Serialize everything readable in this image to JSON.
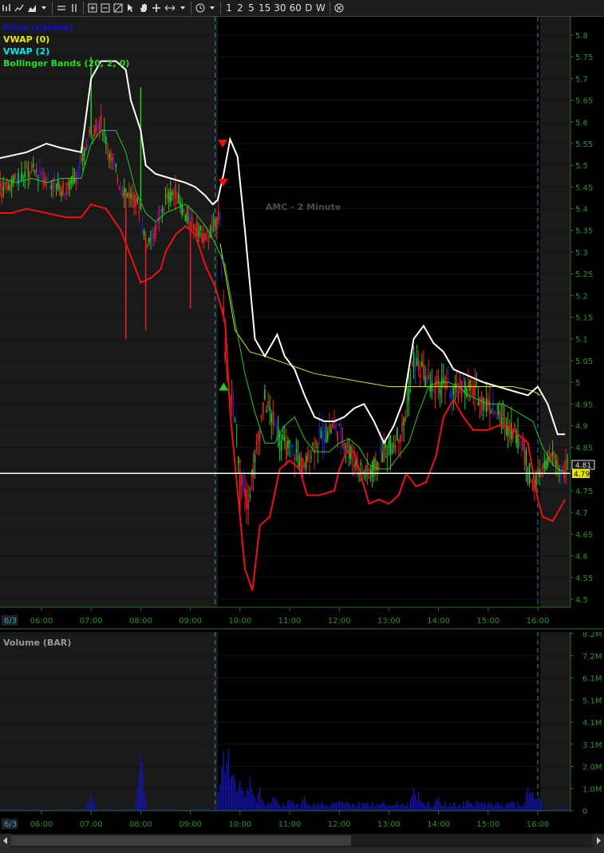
{
  "toolbar": {
    "timeframes": [
      "1",
      "2",
      "5",
      "15",
      "30",
      "60",
      "D",
      "W"
    ]
  },
  "chart_data": [
    {
      "type": "candlestick",
      "title": "AMC - 2 Minute",
      "legend": [
        {
          "name": "Price (Candle)",
          "color": "#1010d0"
        },
        {
          "name": "VWAP (0)",
          "color": "#e8e800"
        },
        {
          "name": "VWAP (2)",
          "color": "#00e8e8"
        },
        {
          "name": "Bollinger Bands (20, 2, 0)",
          "color": "#22dd22"
        }
      ],
      "ylim": [
        4.5,
        5.8
      ],
      "y_ticks": [
        "5.8",
        "5.75",
        "5.7",
        "5.65",
        "5.6",
        "5.55",
        "5.5",
        "5.45",
        "5.4",
        "5.35",
        "5.3",
        "5.25",
        "5.2",
        "5.15",
        "5.1",
        "5.05",
        "5",
        "4.95",
        "4.9",
        "4.85",
        "4.8",
        "4.75",
        "4.7",
        "4.65",
        "4.6",
        "4.55",
        "4.5"
      ],
      "x_ticks": [
        "06:00",
        "07:00",
        "08:00",
        "09:00",
        "10:00",
        "11:00",
        "12:00",
        "13:00",
        "14:00",
        "15:00",
        "16:00"
      ],
      "date_label": "6/3",
      "last_price_labels": [
        "4.81",
        "4.79"
      ],
      "horizontal_line": 4.79,
      "session_markers": [
        "09:30",
        "16:00"
      ],
      "series": {
        "bb_upper": [
          [
            4.0,
            5.74
          ],
          [
            4.2,
            5.63
          ],
          [
            4.5,
            5.52
          ],
          [
            4.9,
            5.51
          ],
          [
            5.3,
            5.52
          ],
          [
            5.7,
            5.53
          ],
          [
            6.1,
            5.55
          ],
          [
            6.4,
            5.54
          ],
          [
            6.8,
            5.53
          ],
          [
            7.0,
            5.7
          ],
          [
            7.2,
            5.74
          ],
          [
            7.5,
            5.74
          ],
          [
            7.7,
            5.72
          ],
          [
            7.8,
            5.65
          ],
          [
            8.0,
            5.58
          ],
          [
            8.1,
            5.5
          ],
          [
            8.3,
            5.48
          ],
          [
            8.6,
            5.47
          ],
          [
            8.9,
            5.46
          ],
          [
            9.1,
            5.45
          ],
          [
            9.3,
            5.43
          ],
          [
            9.45,
            5.41
          ],
          [
            9.55,
            5.42
          ],
          [
            9.67,
            5.48
          ],
          [
            9.8,
            5.56
          ],
          [
            9.95,
            5.52
          ],
          [
            10.1,
            5.35
          ],
          [
            10.3,
            5.1
          ],
          [
            10.5,
            5.06
          ],
          [
            10.6,
            5.08
          ],
          [
            10.75,
            5.11
          ],
          [
            10.9,
            5.06
          ],
          [
            11.1,
            5.03
          ],
          [
            11.3,
            4.97
          ],
          [
            11.5,
            4.92
          ],
          [
            11.7,
            4.91
          ],
          [
            11.9,
            4.91
          ],
          [
            12.1,
            4.92
          ],
          [
            12.3,
            4.94
          ],
          [
            12.5,
            4.95
          ],
          [
            12.7,
            4.91
          ],
          [
            12.9,
            4.86
          ],
          [
            13.1,
            4.9
          ],
          [
            13.3,
            4.96
          ],
          [
            13.5,
            5.1
          ],
          [
            13.7,
            5.13
          ],
          [
            13.9,
            5.09
          ],
          [
            14.1,
            5.07
          ],
          [
            14.3,
            5.03
          ],
          [
            14.5,
            5.02
          ],
          [
            14.7,
            5.01
          ],
          [
            14.9,
            5.0
          ],
          [
            15.2,
            4.99
          ],
          [
            15.5,
            4.98
          ],
          [
            15.8,
            4.97
          ],
          [
            16.0,
            4.99
          ],
          [
            16.2,
            4.95
          ],
          [
            16.4,
            4.88
          ],
          [
            16.55,
            4.88
          ]
        ],
        "bb_lower": [
          [
            4.0,
            5.3
          ],
          [
            4.3,
            5.28
          ],
          [
            4.6,
            5.33
          ],
          [
            4.9,
            5.38
          ],
          [
            5.1,
            5.39
          ],
          [
            5.4,
            5.39
          ],
          [
            5.7,
            5.4
          ],
          [
            6.1,
            5.39
          ],
          [
            6.5,
            5.38
          ],
          [
            6.8,
            5.38
          ],
          [
            7.0,
            5.41
          ],
          [
            7.3,
            5.4
          ],
          [
            7.6,
            5.35
          ],
          [
            7.8,
            5.29
          ],
          [
            8.0,
            5.23
          ],
          [
            8.2,
            5.24
          ],
          [
            8.4,
            5.26
          ],
          [
            8.5,
            5.3
          ],
          [
            8.7,
            5.34
          ],
          [
            8.9,
            5.36
          ],
          [
            9.1,
            5.34
          ],
          [
            9.3,
            5.27
          ],
          [
            9.5,
            5.22
          ],
          [
            9.7,
            5.14
          ],
          [
            9.8,
            4.93
          ],
          [
            9.95,
            4.75
          ],
          [
            10.1,
            4.57
          ],
          [
            10.25,
            4.52
          ],
          [
            10.4,
            4.67
          ],
          [
            10.6,
            4.69
          ],
          [
            10.8,
            4.8
          ],
          [
            11.0,
            4.82
          ],
          [
            11.2,
            4.8
          ],
          [
            11.35,
            4.74
          ],
          [
            11.6,
            4.74
          ],
          [
            11.9,
            4.75
          ],
          [
            12.0,
            4.8
          ],
          [
            12.15,
            4.84
          ],
          [
            12.3,
            4.84
          ],
          [
            12.45,
            4.78
          ],
          [
            12.6,
            4.72
          ],
          [
            12.8,
            4.73
          ],
          [
            13.0,
            4.72
          ],
          [
            13.2,
            4.74
          ],
          [
            13.35,
            4.79
          ],
          [
            13.55,
            4.76
          ],
          [
            13.75,
            4.77
          ],
          [
            13.95,
            4.83
          ],
          [
            14.1,
            4.92
          ],
          [
            14.3,
            4.96
          ],
          [
            14.5,
            4.92
          ],
          [
            14.7,
            4.89
          ],
          [
            15.0,
            4.89
          ],
          [
            15.2,
            4.9
          ],
          [
            15.4,
            4.9
          ],
          [
            15.6,
            4.88
          ],
          [
            15.8,
            4.86
          ],
          [
            16.0,
            4.73
          ],
          [
            16.1,
            4.69
          ],
          [
            16.3,
            4.68
          ],
          [
            16.55,
            4.73
          ]
        ],
        "bb_mid": [
          [
            4.0,
            5.53
          ],
          [
            4.3,
            5.46
          ],
          [
            4.6,
            5.42
          ],
          [
            4.9,
            5.46
          ],
          [
            5.2,
            5.47
          ],
          [
            5.5,
            5.46
          ],
          [
            5.8,
            5.47
          ],
          [
            6.1,
            5.46
          ],
          [
            6.4,
            5.47
          ],
          [
            6.8,
            5.47
          ],
          [
            7.0,
            5.55
          ],
          [
            7.2,
            5.58
          ],
          [
            7.5,
            5.58
          ],
          [
            7.7,
            5.53
          ],
          [
            7.9,
            5.44
          ],
          [
            8.1,
            5.39
          ],
          [
            8.3,
            5.37
          ],
          [
            8.5,
            5.39
          ],
          [
            8.7,
            5.4
          ],
          [
            8.9,
            5.41
          ],
          [
            9.1,
            5.39
          ],
          [
            9.3,
            5.36
          ],
          [
            9.5,
            5.32
          ],
          [
            9.7,
            5.27
          ],
          [
            9.9,
            5.14
          ],
          [
            10.1,
            5.02
          ],
          [
            10.3,
            4.93
          ],
          [
            10.5,
            4.86
          ],
          [
            10.7,
            4.86
          ],
          [
            10.9,
            4.9
          ],
          [
            11.1,
            4.92
          ],
          [
            11.3,
            4.87
          ],
          [
            11.5,
            4.84
          ],
          [
            11.8,
            4.84
          ],
          [
            12.0,
            4.86
          ],
          [
            12.2,
            4.87
          ],
          [
            12.4,
            4.85
          ],
          [
            12.6,
            4.81
          ],
          [
            12.8,
            4.8
          ],
          [
            13.0,
            4.8
          ],
          [
            13.2,
            4.83
          ],
          [
            13.4,
            4.86
          ],
          [
            13.6,
            4.93
          ],
          [
            13.8,
            4.99
          ],
          [
            14.0,
            5.0
          ],
          [
            14.2,
            5.0
          ],
          [
            14.4,
            4.99
          ],
          [
            14.6,
            4.97
          ],
          [
            14.8,
            4.96
          ],
          [
            15.0,
            4.95
          ],
          [
            15.3,
            4.95
          ],
          [
            15.6,
            4.93
          ],
          [
            15.9,
            4.91
          ],
          [
            16.1,
            4.85
          ],
          [
            16.3,
            4.81
          ],
          [
            16.55,
            4.79
          ]
        ],
        "vwap": [
          [
            9.6,
            5.32
          ],
          [
            9.9,
            5.12
          ],
          [
            10.2,
            5.07
          ],
          [
            10.5,
            5.06
          ],
          [
            11.0,
            5.04
          ],
          [
            11.5,
            5.02
          ],
          [
            12.0,
            5.01
          ],
          [
            12.5,
            5.0
          ],
          [
            13.0,
            4.99
          ],
          [
            13.5,
            4.99
          ],
          [
            14.0,
            4.99
          ],
          [
            14.5,
            4.99
          ],
          [
            15.0,
            4.99
          ],
          [
            15.5,
            4.99
          ],
          [
            15.9,
            4.98
          ],
          [
            16.05,
            4.97
          ]
        ],
        "price_path": [
          [
            4.0,
            5.4
          ],
          [
            4.3,
            5.38
          ],
          [
            4.6,
            5.45
          ],
          [
            4.9,
            5.48
          ],
          [
            5.2,
            5.44
          ],
          [
            5.5,
            5.47
          ],
          [
            5.8,
            5.49
          ],
          [
            6.2,
            5.46
          ],
          [
            6.5,
            5.44
          ],
          [
            6.8,
            5.5
          ],
          [
            7.0,
            5.58
          ],
          [
            7.2,
            5.6
          ],
          [
            7.4,
            5.52
          ],
          [
            7.6,
            5.45
          ],
          [
            7.8,
            5.43
          ],
          [
            8.0,
            5.4
          ],
          [
            8.1,
            5.32
          ],
          [
            8.3,
            5.35
          ],
          [
            8.5,
            5.42
          ],
          [
            8.7,
            5.44
          ],
          [
            8.9,
            5.38
          ],
          [
            9.1,
            5.36
          ],
          [
            9.3,
            5.33
          ],
          [
            9.5,
            5.36
          ],
          [
            9.6,
            5.4
          ],
          [
            9.7,
            5.05
          ],
          [
            9.85,
            4.95
          ],
          [
            10.0,
            4.8
          ],
          [
            10.15,
            4.72
          ],
          [
            10.3,
            4.82
          ],
          [
            10.5,
            4.96
          ],
          [
            10.7,
            4.9
          ],
          [
            10.9,
            4.85
          ],
          [
            11.1,
            4.84
          ],
          [
            11.3,
            4.8
          ],
          [
            11.5,
            4.86
          ],
          [
            11.7,
            4.88
          ],
          [
            11.9,
            4.9
          ],
          [
            12.1,
            4.87
          ],
          [
            12.3,
            4.82
          ],
          [
            12.5,
            4.79
          ],
          [
            12.7,
            4.8
          ],
          [
            12.9,
            4.84
          ],
          [
            13.1,
            4.86
          ],
          [
            13.3,
            4.9
          ],
          [
            13.5,
            5.05
          ],
          [
            13.7,
            5.02
          ],
          [
            13.9,
            4.98
          ],
          [
            14.1,
            5.0
          ],
          [
            14.3,
            4.97
          ],
          [
            14.5,
            4.99
          ],
          [
            14.7,
            4.98
          ],
          [
            14.9,
            4.96
          ],
          [
            15.1,
            4.94
          ],
          [
            15.3,
            4.91
          ],
          [
            15.5,
            4.89
          ],
          [
            15.7,
            4.85
          ],
          [
            15.9,
            4.76
          ],
          [
            16.1,
            4.8
          ],
          [
            16.3,
            4.83
          ],
          [
            16.5,
            4.79
          ],
          [
            16.6,
            4.81
          ]
        ],
        "candle_spikes": [
          [
            7.0,
            5.75
          ],
          [
            8.0,
            5.68
          ],
          [
            8.1,
            5.12
          ],
          [
            7.7,
            5.1
          ],
          [
            9.0,
            5.17
          ],
          [
            10.0,
            4.7
          ],
          [
            10.25,
            4.8
          ]
        ],
        "sell_arrows": [
          [
            9.65,
            5.55
          ],
          [
            9.66,
            5.46
          ]
        ],
        "buy_arrows": [
          [
            9.67,
            4.99
          ]
        ]
      }
    },
    {
      "type": "bar",
      "title": "Volume (BAR)",
      "ylim": [
        0,
        8200000
      ],
      "y_ticks": [
        "8.2M",
        "7.2M",
        "6.1M",
        "5.1M",
        "4.1M",
        "3.1M",
        "2.0M",
        "1.0M",
        "0"
      ],
      "x_ticks": [
        "06:00",
        "07:00",
        "08:00",
        "09:00",
        "10:00",
        "11:00",
        "12:00",
        "13:00",
        "14:00",
        "15:00",
        "16:00"
      ],
      "date_label": "6/3",
      "spikes": [
        [
          7.0,
          1100000
        ],
        [
          8.0,
          3100000
        ],
        [
          9.65,
          3300000
        ],
        [
          9.75,
          4000000
        ],
        [
          9.85,
          2800000
        ],
        [
          10.0,
          2200000
        ],
        [
          10.2,
          1600000
        ],
        [
          10.4,
          1100000
        ],
        [
          10.7,
          900000
        ],
        [
          11.0,
          700000
        ],
        [
          11.3,
          850000
        ],
        [
          12.0,
          550000
        ],
        [
          12.5,
          500000
        ],
        [
          13.5,
          1200000
        ],
        [
          13.6,
          900000
        ],
        [
          14.0,
          700000
        ],
        [
          14.6,
          650000
        ],
        [
          15.0,
          500000
        ],
        [
          15.8,
          1500000
        ],
        [
          15.9,
          1200000
        ],
        [
          16.0,
          900000
        ]
      ]
    }
  ]
}
